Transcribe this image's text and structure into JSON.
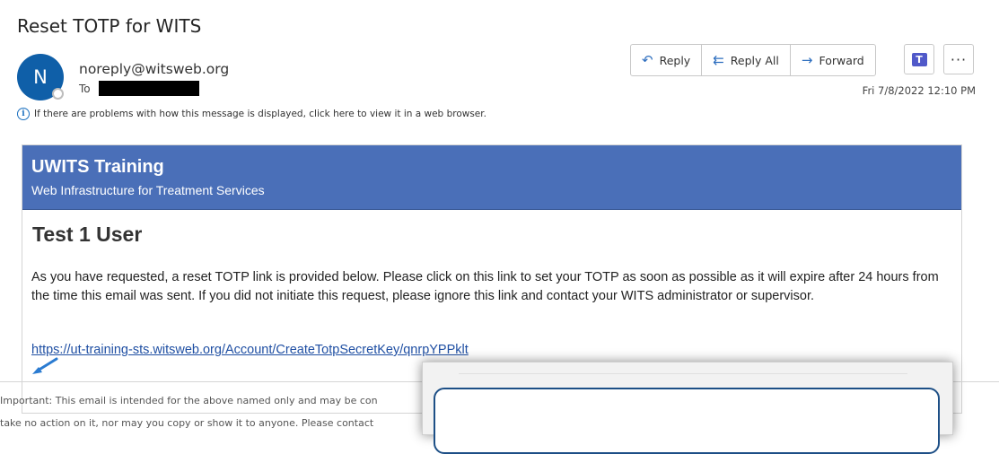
{
  "email": {
    "subject": "Reset TOTP for WITS",
    "avatar_initial": "N",
    "sender": "noreply@witsweb.org",
    "to_label": "To",
    "date": "Fri 7/8/2022 12:10 PM",
    "info_bar": "If there are problems with how this message is displayed, click here to view it in a web browser."
  },
  "toolbar": {
    "reply": "Reply",
    "reply_all": "Reply All",
    "forward": "Forward",
    "more": "···",
    "teams_letter": "T"
  },
  "body": {
    "banner_title": "UWITS Training",
    "banner_subtitle": "Web Infrastructure for Treatment Services",
    "user_name": "Test 1 User",
    "message": "As you have requested, a reset TOTP link is provided below. Please click on this link to set your TOTP as soon as possible as it will expire after 24 hours from the time this email was sent. If you did not initiate this request, please ignore this link and contact your WITS administrator or supervisor.",
    "link": "https://ut-training-sts.witsweb.org/Account/CreateTotpSecretKey/qnrpYPPklt"
  },
  "footer": {
    "disclaimer_line1": "Important: This email is intended for the above named only and may be con",
    "disclaimer_line2": "take no action on it, nor may you copy or show it to anyone. Please contact"
  },
  "colors": {
    "banner": "#4a6fb8",
    "avatar": "#0f5fa8",
    "link": "#1f4fa3",
    "accent_icon": "#2f6fbf"
  }
}
